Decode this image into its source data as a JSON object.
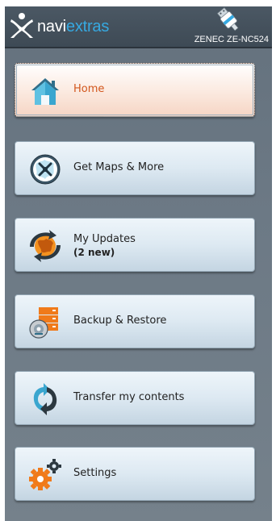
{
  "header": {
    "brand_part1": "navi",
    "brand_part2": "extras",
    "device_name": "ZENEC ZE-NC524",
    "colors": {
      "brand_accent": "#36a9e1",
      "header_bg": "#45515c"
    }
  },
  "menu": {
    "active_color": "#d2561c",
    "items": [
      {
        "label": "Home",
        "icon": "home-icon",
        "active": true
      },
      {
        "label": "Get Maps & More",
        "icon": "globe-compass-icon",
        "active": false
      },
      {
        "label": "My Updates",
        "sublabel": "(2 new)",
        "icon": "globe-sync-icon",
        "active": false
      },
      {
        "label": "Backup & Restore",
        "icon": "backup-disk-icon",
        "active": false
      },
      {
        "label": "Transfer my contents",
        "icon": "transfer-arrows-icon",
        "active": false
      },
      {
        "label": "Settings",
        "icon": "gears-icon",
        "active": false
      }
    ]
  }
}
